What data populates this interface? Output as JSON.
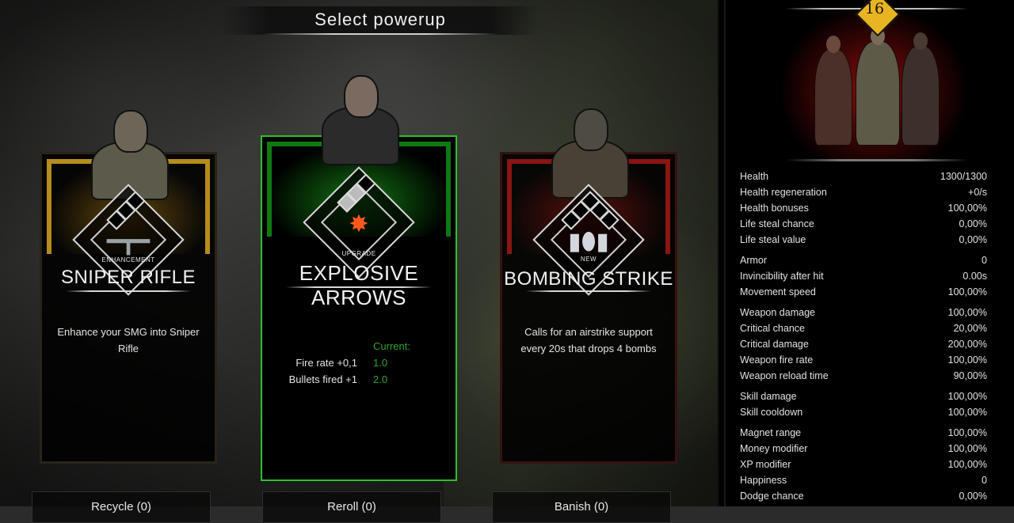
{
  "title": "Select powerup",
  "cards": [
    {
      "type": "ENHANCEMENT",
      "name": "SNIPER RIFLE",
      "description": "Enhance your SMG into Sniper Rifle",
      "accent": "#b68a1c",
      "icon": "sniper-rifle-icon",
      "selected": false
    },
    {
      "type": "UPGRADE",
      "name": "EXPLOSIVE ARROWS",
      "description": "",
      "accent": "#2fbf2f",
      "icon": "explosive-arrow-icon",
      "selected": true,
      "current_label": "Current:",
      "stats": [
        {
          "label": "Fire rate +0,1",
          "current": "1.0"
        },
        {
          "label": "Bullets fired +1",
          "current": "2.0"
        }
      ]
    },
    {
      "type": "NEW",
      "name": "BOMBING STRIKE",
      "description": "Calls for an airstrike support every 20s that drops 4 bombs",
      "accent": "#8a1612",
      "icon": "bomb-icon",
      "selected": false
    }
  ],
  "actions": [
    {
      "label": "Recycle (0)"
    },
    {
      "label": "Reroll (0)"
    },
    {
      "label": "Banish (0)"
    }
  ],
  "panel": {
    "level": "16",
    "level_color": "#e9b422",
    "stat_groups": [
      [
        {
          "name": "Health",
          "value": "1300/1300"
        },
        {
          "name": "Health regeneration",
          "value": "+0/s"
        },
        {
          "name": "Health bonuses",
          "value": "100,00%"
        },
        {
          "name": "Life steal chance",
          "value": "0,00%"
        },
        {
          "name": "Life steal value",
          "value": "0,00%"
        }
      ],
      [
        {
          "name": "Armor",
          "value": "0"
        },
        {
          "name": "Invincibility after hit",
          "value": "0.00s"
        },
        {
          "name": "Movement speed",
          "value": "100,00%"
        }
      ],
      [
        {
          "name": "Weapon damage",
          "value": "100,00%"
        },
        {
          "name": "Critical chance",
          "value": "20,00%"
        },
        {
          "name": "Critical damage",
          "value": "200,00%"
        },
        {
          "name": "Weapon fire rate",
          "value": "100,00%"
        },
        {
          "name": "Weapon reload time",
          "value": "90,00%"
        }
      ],
      [
        {
          "name": "Skill damage",
          "value": "100,00%"
        },
        {
          "name": "Skill cooldown",
          "value": "100,00%"
        }
      ],
      [
        {
          "name": "Magnet range",
          "value": "100,00%"
        },
        {
          "name": "Money modifier",
          "value": "100,00%"
        },
        {
          "name": "XP modifier",
          "value": "100,00%"
        },
        {
          "name": "Happiness",
          "value": "0"
        },
        {
          "name": "Dodge chance",
          "value": "0,00%"
        }
      ]
    ]
  }
}
